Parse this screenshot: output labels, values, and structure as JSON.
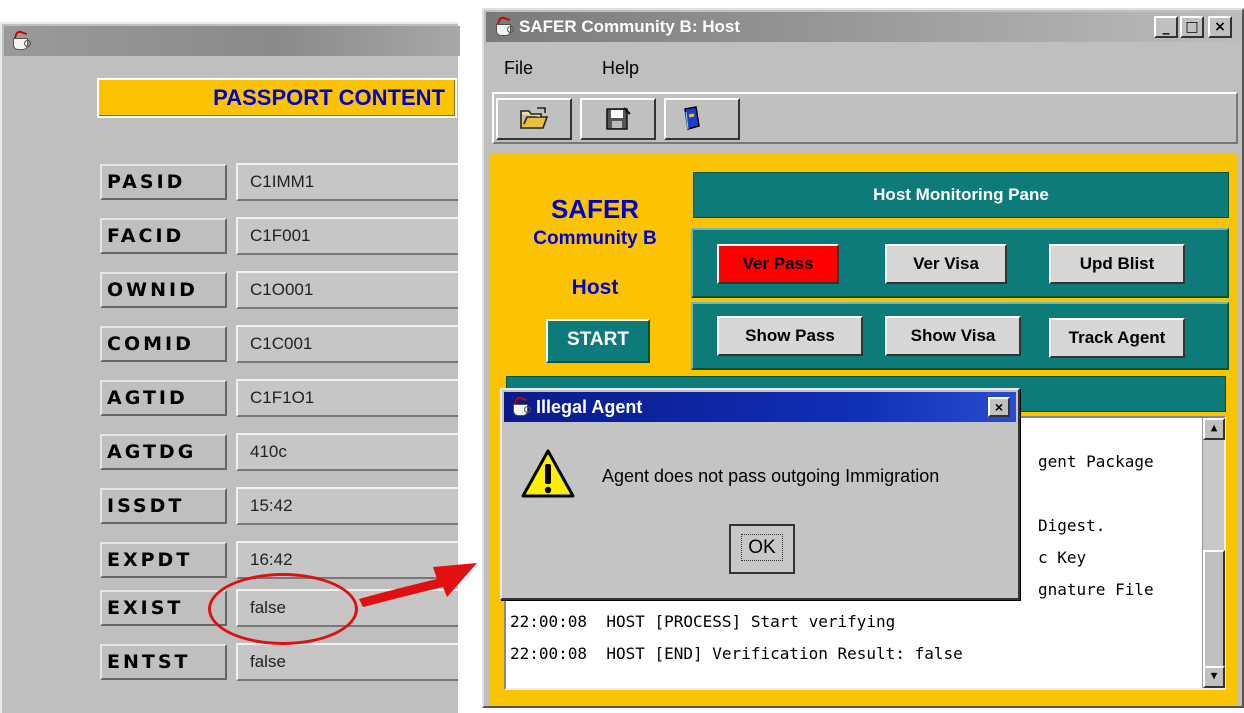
{
  "passport_window": {
    "header": "PASSPORT CONTENT",
    "rows": [
      {
        "label": "PASID",
        "value": "C1IMM1"
      },
      {
        "label": "FACID",
        "value": "C1F001"
      },
      {
        "label": "OWNID",
        "value": "C1O001"
      },
      {
        "label": "COMID",
        "value": "C1C001"
      },
      {
        "label": "AGTID",
        "value": "C1F1O1"
      },
      {
        "label": "AGTDG",
        "value": "410c"
      },
      {
        "label": "ISSDT",
        "value": "15:42"
      },
      {
        "label": "EXPDT",
        "value": "16:42"
      },
      {
        "label": "EXIST",
        "value": "false"
      },
      {
        "label": "ENTST",
        "value": "false"
      }
    ]
  },
  "safer_window": {
    "title": "SAFER Community B: Host",
    "window_buttons": [
      "_",
      "□",
      "×"
    ],
    "menu": [
      "File",
      "Help"
    ],
    "toolbar_icons": [
      "open-folder-icon",
      "save-disk-icon",
      "book-icon"
    ],
    "side": {
      "title": "SAFER",
      "community": "Community B",
      "role": "Host",
      "start": "START"
    },
    "monitor_title": "Host Monitoring Pane",
    "row1_buttons": [
      "Ver Pass",
      "Ver Visa",
      "Upd Blist"
    ],
    "row2_buttons": [
      "Show Pass",
      "Show Visa",
      "Track Agent"
    ],
    "log_lines_partial": [
      "gent Package",
      "Digest.",
      "c Key",
      "gnature File"
    ],
    "log_lines": [
      "22:00:08  HOST [PROCESS] Start verifying",
      "22:00:08  HOST [END] Verification Result: false"
    ]
  },
  "dialog": {
    "title": "Illegal Agent",
    "close": "×",
    "message": "Agent does not pass outgoing Immigration",
    "ok": "OK"
  },
  "colors": {
    "accent_yellow": "#fcc400",
    "teal": "#0e7b7b",
    "header_blue": "#0000cc",
    "alert_red": "#ff0000",
    "annotation_red": "#e01010"
  }
}
